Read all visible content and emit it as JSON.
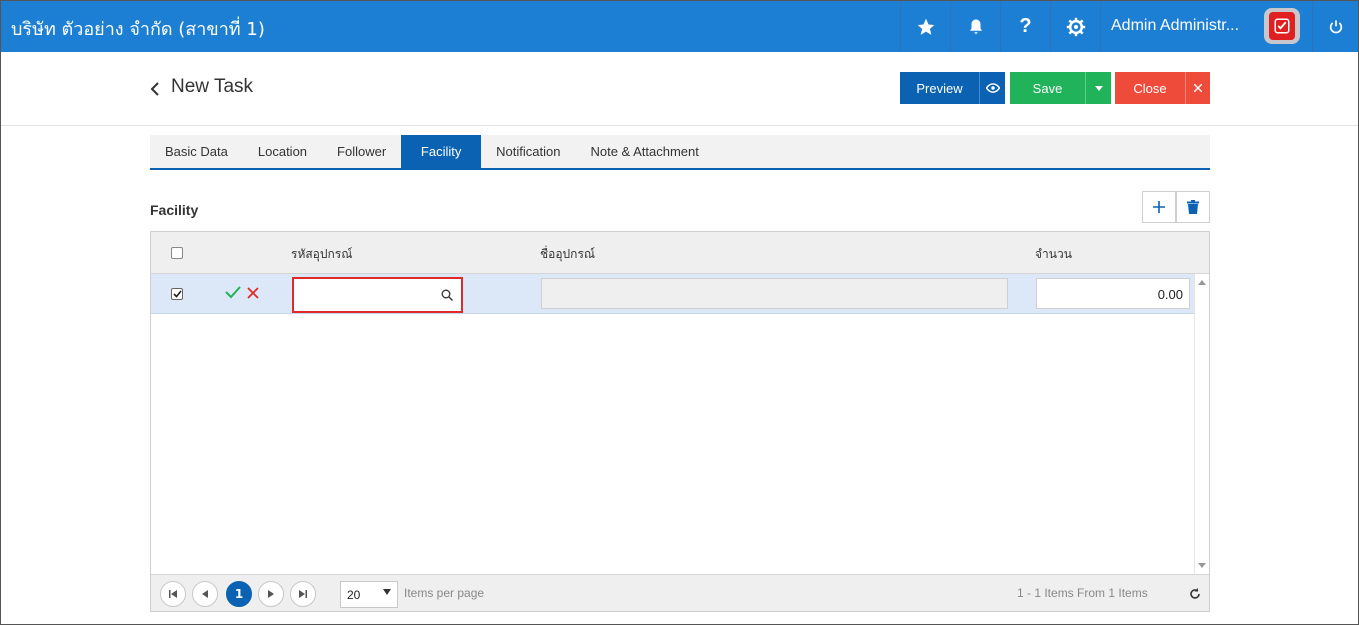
{
  "topbar": {
    "company": "บริษัท ตัวอย่าง จำกัด (สาขาที่ 1)",
    "user_name": "Admin Administr...",
    "icons": [
      "star-icon",
      "bell-icon",
      "help-icon",
      "gear-icon",
      "power-icon"
    ],
    "background": "#1c7fd4"
  },
  "header": {
    "title": "New Task",
    "preview_label": "Preview",
    "save_label": "Save",
    "close_label": "Close"
  },
  "tabs": [
    {
      "label": "Basic Data",
      "active": false
    },
    {
      "label": "Location",
      "active": false
    },
    {
      "label": "Follower",
      "active": false
    },
    {
      "label": "Facility",
      "active": true
    },
    {
      "label": "Notification",
      "active": false
    },
    {
      "label": "Note & Attachment",
      "active": false
    }
  ],
  "section": {
    "title": "Facility"
  },
  "grid": {
    "columns": {
      "code": "รหัสอุปกรณ์",
      "name": "ชื่ออุปกรณ์",
      "quantity": "จำนวน"
    },
    "rows": [
      {
        "checked": true,
        "code": "",
        "name": "",
        "quantity": "0.00"
      }
    ]
  },
  "pager": {
    "current_page": "1",
    "page_size": "20",
    "items_per_page_label": "Items per page",
    "summary": "1 - 1 Items From 1 Items"
  },
  "colors": {
    "primary": "#0b62b3",
    "save": "#21b35a",
    "close": "#ef4b3a",
    "highlight_border": "#e02a2a"
  }
}
